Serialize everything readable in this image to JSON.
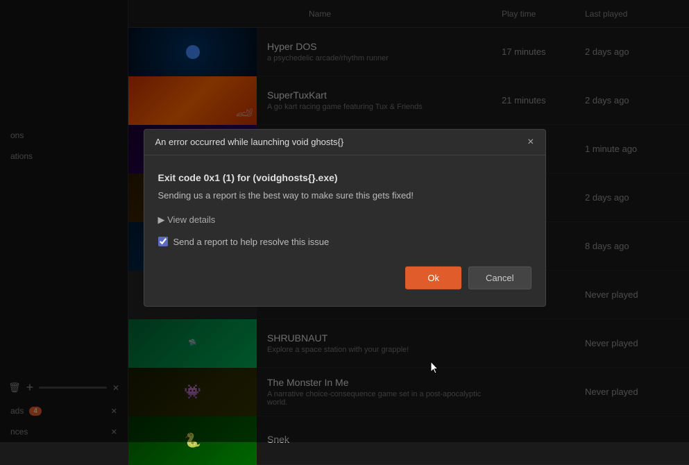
{
  "header": {
    "col_name": "Name",
    "col_playtime": "Play time",
    "col_lastplayed": "Last played"
  },
  "sidebar": {
    "item1_label": "ons",
    "item2_label": "ations",
    "downloads_label": "ads",
    "downloads_count": "4",
    "friends_label": "nces",
    "controls_label": "+ -"
  },
  "games": [
    {
      "title": "Hyper DOS",
      "desc": "a psychedelic arcade/rhythm runner",
      "playtime": "17 minutes",
      "lastplayed": "2 days ago",
      "thumb_class": "thumb-hyper",
      "has_dot": true
    },
    {
      "title": "SuperTuxKart",
      "desc": "A go kart racing game featuring Tux & Friends",
      "playtime": "21 minutes",
      "lastplayed": "2 days ago",
      "thumb_class": "thumb-tuxkart",
      "has_dot": false
    },
    {
      "title": "",
      "desc": "",
      "playtime": "",
      "lastplayed": "1 minute ago",
      "thumb_class": "thumb-void",
      "has_dot": false
    },
    {
      "title": "",
      "desc": "",
      "playtime": "",
      "lastplayed": "2 days ago",
      "thumb_class": "thumb-void2",
      "has_dot": false
    },
    {
      "title": "",
      "desc": "",
      "playtime": "",
      "lastplayed": "8 days ago",
      "thumb_class": "thumb-void3",
      "has_dot": false
    },
    {
      "title": "",
      "desc": "",
      "playtime": "",
      "lastplayed": "Never played",
      "thumb_class": "thumb-void4",
      "has_dot": false
    },
    {
      "title": "SHRUBNAUT",
      "desc": "Explore a space station with your grapple!",
      "playtime": "",
      "lastplayed": "Never played",
      "thumb_class": "thumb-shrubnaut",
      "has_dot": false
    },
    {
      "title": "The Monster In Me",
      "desc": "A narrative choice-consequence game set in a post-apocalyptic world.",
      "playtime": "",
      "lastplayed": "Never played",
      "thumb_class": "thumb-monster",
      "has_dot": false
    },
    {
      "title": "Snek",
      "desc": "",
      "playtime": "",
      "lastplayed": "",
      "thumb_class": "thumb-snek",
      "has_dot": false
    }
  ],
  "dialog": {
    "title": "An error occurred while launching void ghosts{}",
    "close_label": "×",
    "error_title": "Exit code 0x1 (1) for (voidghosts{}.exe)",
    "error_msg": "Sending us a report is the best way to make sure this gets fixed!",
    "details_label": "▶ View details",
    "checkbox_label": "Send a report to help resolve this issue",
    "ok_label": "Ok",
    "cancel_label": "Cancel"
  }
}
